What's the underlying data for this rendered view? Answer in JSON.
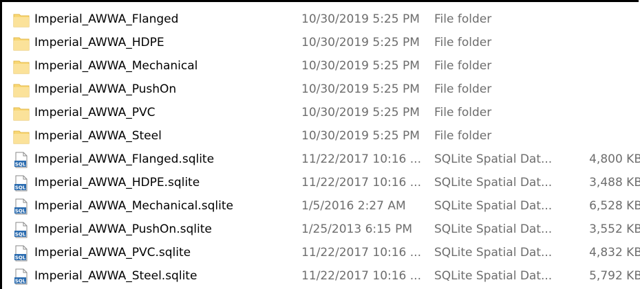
{
  "files": [
    {
      "name": "Imperial_AWWA_Flanged",
      "date_modified": "10/30/2019 5:25 PM",
      "type": "File folder",
      "size": "",
      "icon": "folder-icon"
    },
    {
      "name": "Imperial_AWWA_HDPE",
      "date_modified": "10/30/2019 5:25 PM",
      "type": "File folder",
      "size": "",
      "icon": "folder-icon"
    },
    {
      "name": "Imperial_AWWA_Mechanical",
      "date_modified": "10/30/2019 5:25 PM",
      "type": "File folder",
      "size": "",
      "icon": "folder-icon"
    },
    {
      "name": "Imperial_AWWA_PushOn",
      "date_modified": "10/30/2019 5:25 PM",
      "type": "File folder",
      "size": "",
      "icon": "folder-icon"
    },
    {
      "name": "Imperial_AWWA_PVC",
      "date_modified": "10/30/2019 5:25 PM",
      "type": "File folder",
      "size": "",
      "icon": "folder-icon"
    },
    {
      "name": "Imperial_AWWA_Steel",
      "date_modified": "10/30/2019 5:25 PM",
      "type": "File folder",
      "size": "",
      "icon": "folder-icon"
    },
    {
      "name": "Imperial_AWWA_Flanged.sqlite",
      "date_modified": "11/22/2017 10:16 ...",
      "type": "SQLite Spatial Dat...",
      "size": "4,800 KB",
      "icon": "sql-file-icon"
    },
    {
      "name": "Imperial_AWWA_HDPE.sqlite",
      "date_modified": "11/22/2017 10:16 ...",
      "type": "SQLite Spatial Dat...",
      "size": "3,488 KB",
      "icon": "sql-file-icon"
    },
    {
      "name": "Imperial_AWWA_Mechanical.sqlite",
      "date_modified": "1/5/2016 2:27 AM",
      "type": "SQLite Spatial Dat...",
      "size": "6,528 KB",
      "icon": "sql-file-icon"
    },
    {
      "name": "Imperial_AWWA_PushOn.sqlite",
      "date_modified": "1/25/2013 6:15 PM",
      "type": "SQLite Spatial Dat...",
      "size": "3,552 KB",
      "icon": "sql-file-icon"
    },
    {
      "name": "Imperial_AWWA_PVC.sqlite",
      "date_modified": "11/22/2017 10:16 ...",
      "type": "SQLite Spatial Dat...",
      "size": "4,832 KB",
      "icon": "sql-file-icon"
    },
    {
      "name": "Imperial_AWWA_Steel.sqlite",
      "date_modified": "11/22/2017 10:16 ...",
      "type": "SQLite Spatial Dat...",
      "size": "5,792 KB",
      "icon": "sql-file-icon"
    }
  ],
  "colors": {
    "folder_fill": "#f8d775",
    "folder_shade": "#e3b84a",
    "sql_badge": "#2b6cb0",
    "secondary_text": "#6d6d6d"
  }
}
